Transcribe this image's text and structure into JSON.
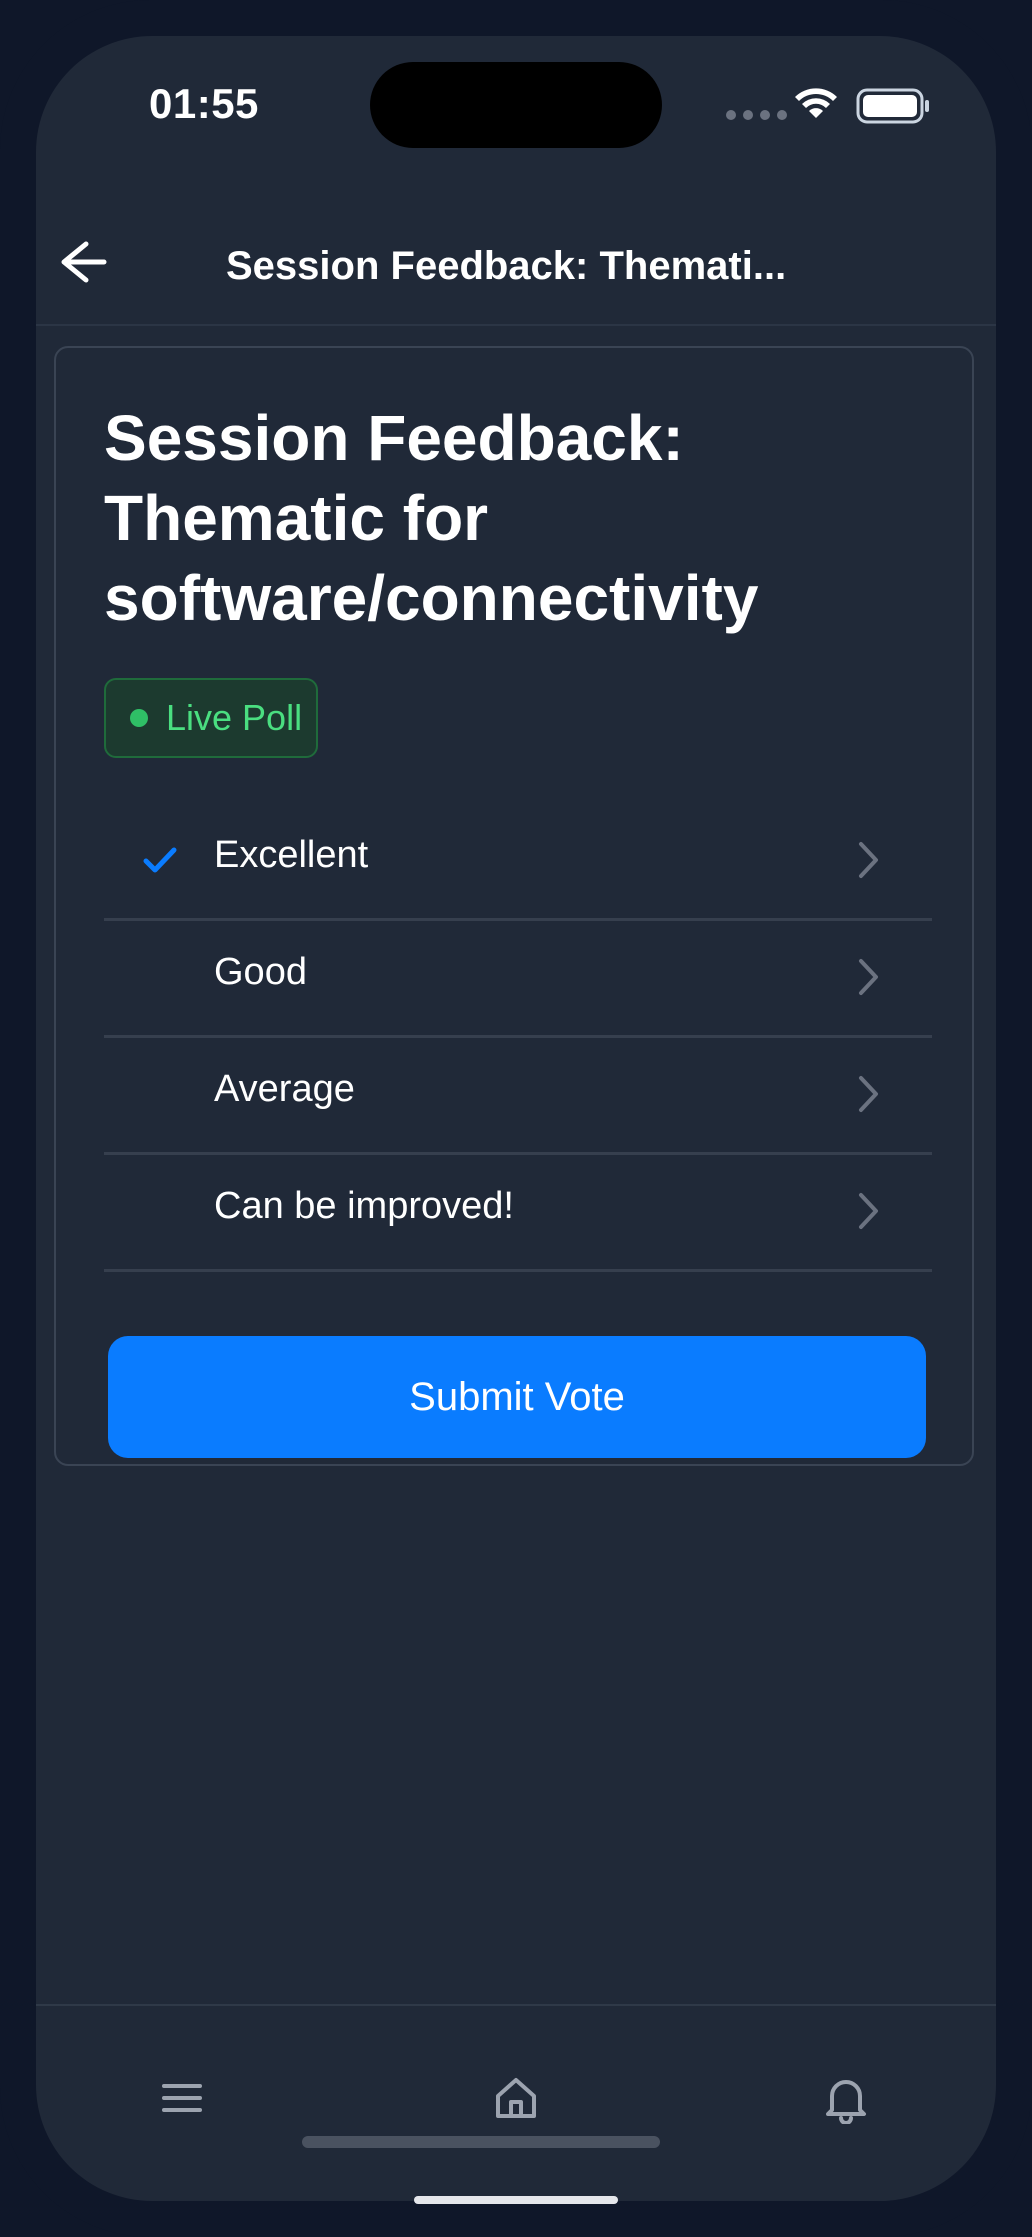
{
  "status_bar": {
    "time": "01:55"
  },
  "header": {
    "title": "Session Feedback: Themati..."
  },
  "poll": {
    "title": "Session Feedback: Thematic for software/connectivity",
    "badge": "Live Poll",
    "options": [
      {
        "label": "Excellent",
        "selected": true
      },
      {
        "label": "Good",
        "selected": false
      },
      {
        "label": "Average",
        "selected": false
      },
      {
        "label": "Can be improved!",
        "selected": false
      }
    ],
    "submit_label": "Submit Vote"
  },
  "bottom_nav": {
    "items": [
      "menu-icon",
      "home-icon",
      "bell-icon"
    ]
  },
  "colors": {
    "background": "#202938",
    "accent": "#0a7cff",
    "live": "#4ade80"
  }
}
